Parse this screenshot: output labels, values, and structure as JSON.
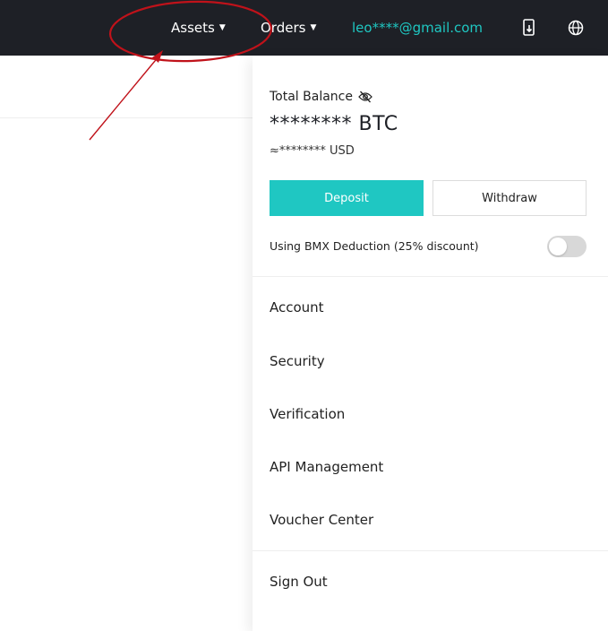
{
  "nav": {
    "assets_label": "Assets",
    "orders_label": "Orders",
    "email": "leo****@gmail.com",
    "download_icon": "download-app-icon",
    "globe_icon": "globe-icon",
    "caret_glyph": "▼"
  },
  "dropdown": {
    "balance_label": "Total Balance",
    "btc_value": "******** BTC",
    "usd_value": "≈******** USD",
    "deposit_label": "Deposit",
    "withdraw_label": "Withdraw",
    "deduction_label": "Using BMX Deduction (25% discount)",
    "deduction_enabled": false,
    "menu": [
      {
        "label": "Account"
      },
      {
        "label": "Security"
      },
      {
        "label": "Verification"
      },
      {
        "label": "API Management"
      },
      {
        "label": "Voucher Center"
      }
    ],
    "sign_out_label": "Sign Out"
  },
  "colors": {
    "topbar": "#1e2026",
    "accent": "#1fc7c2",
    "annotation": "#c0121a"
  }
}
